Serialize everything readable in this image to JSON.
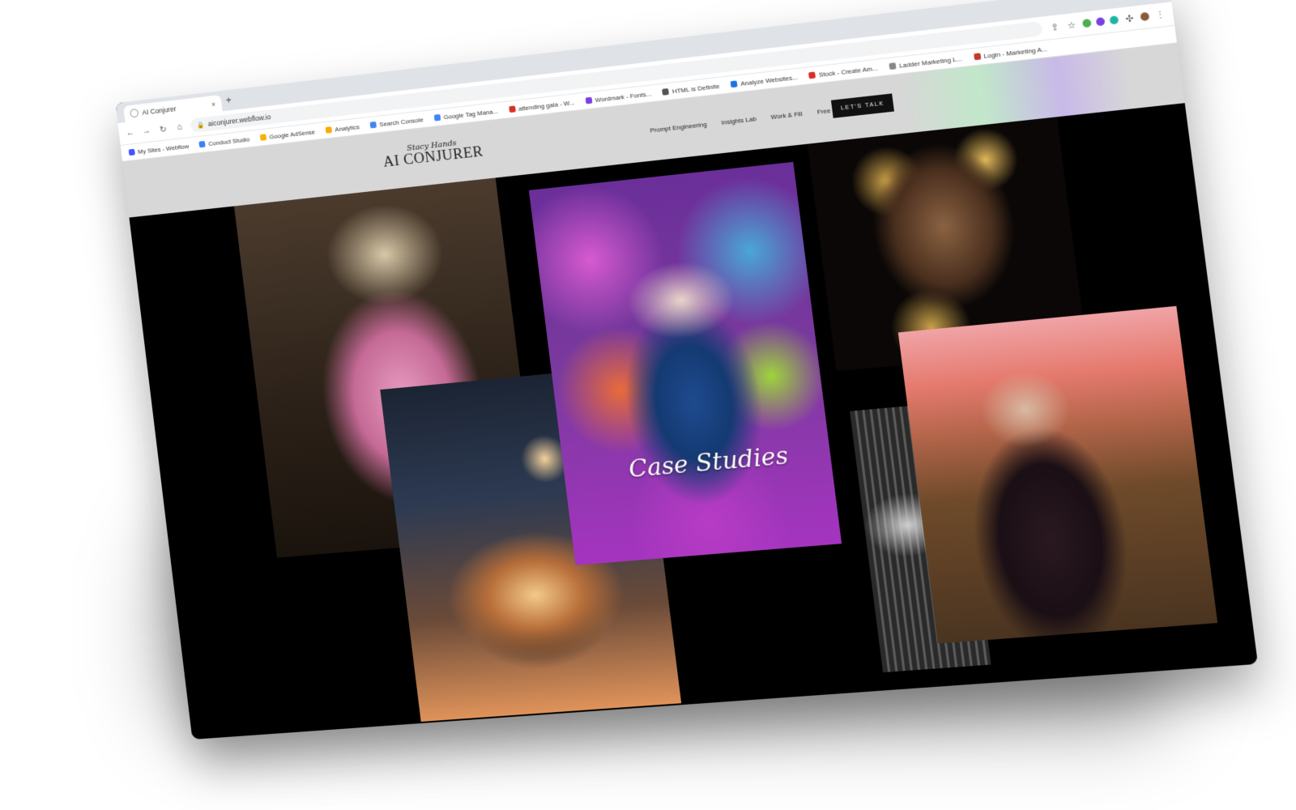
{
  "browser": {
    "tab_title": "AI Conjurer",
    "tab_close": "×",
    "new_tab": "+",
    "window_controls": "⌄  —  ☐  ✕",
    "url": "aiconjurer.webflow.io",
    "bookmarks": [
      {
        "label": "My Sites - Webflow",
        "color": "#4353ff"
      },
      {
        "label": "Conduct Studio",
        "color": "#3b82f6"
      },
      {
        "label": "Google AdSense",
        "color": "#f4b400"
      },
      {
        "label": "Analytics",
        "color": "#f9ab00"
      },
      {
        "label": "Search Console",
        "color": "#4285f4"
      },
      {
        "label": "Google Tag Mana...",
        "color": "#4285f4"
      },
      {
        "label": "attending gala - W...",
        "color": "#d93025"
      },
      {
        "label": "Wordmark - Fonts...",
        "color": "#7b3fe4"
      },
      {
        "label": "HTML is Definite",
        "color": "#555555"
      },
      {
        "label": "Analyze Websites...",
        "color": "#1a73e8"
      },
      {
        "label": "Stock - Create Am...",
        "color": "#d93025"
      },
      {
        "label": "Ladder Marketing L...",
        "color": "#888888"
      },
      {
        "label": "Login - Marketing A...",
        "color": "#c0392b"
      }
    ]
  },
  "site": {
    "logo_script": "Stacy Hands",
    "logo_main": "AI CONJURER",
    "nav": [
      "Prompt Engineering",
      "Insights Lab",
      "Work & Fill",
      "Free Stuff"
    ],
    "cta": "LET'S TALK"
  },
  "hero": {
    "overlay_text": "Case Studies"
  },
  "colors": {
    "header_bg": "#d7d7d7",
    "content_bg": "#000000",
    "cta_bg": "#111111"
  }
}
